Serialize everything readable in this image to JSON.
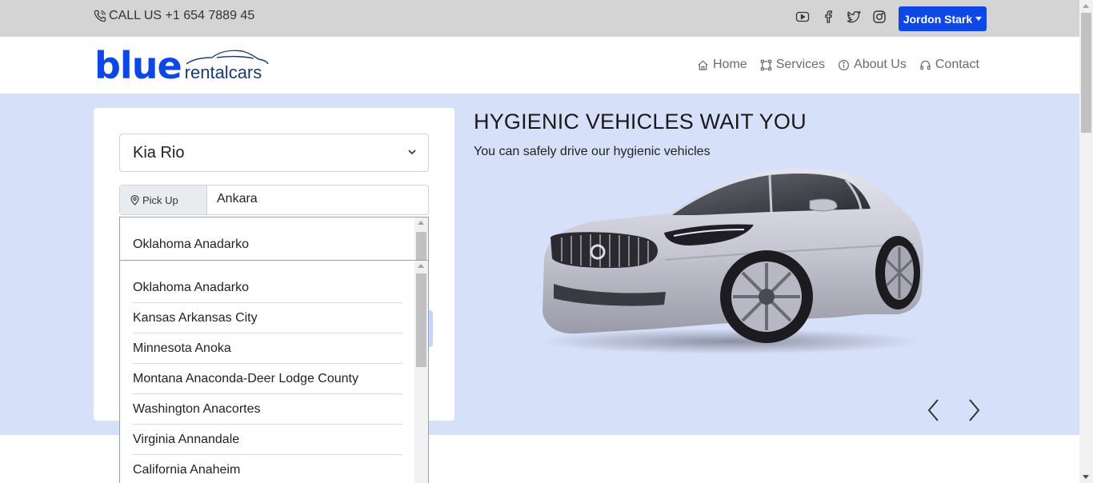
{
  "topbar": {
    "call_text": "CALL US +1 654 7889 45",
    "socials": [
      "youtube-icon",
      "facebook-icon",
      "twitter-icon",
      "instagram-icon"
    ],
    "user_name": "Jordon Stark",
    "bg_color": "#d4d4d4",
    "button_color": "#0d47e6"
  },
  "header": {
    "logo_main": "blue",
    "logo_sub": "rentalcars",
    "nav": [
      {
        "label": "Home",
        "icon": "home-icon"
      },
      {
        "label": "Services",
        "icon": "services-icon"
      },
      {
        "label": "About Us",
        "icon": "info-icon"
      },
      {
        "label": "Contact",
        "icon": "headset-icon"
      }
    ]
  },
  "hero": {
    "title": "HYGIENIC VEHICLES WAIT YOU",
    "subtitle": "You can safely drive our hygienic vehicles",
    "bg_color": "#d7e0f9"
  },
  "form": {
    "car_select": "Kia Rio",
    "pickup_label": "Pick Up",
    "pickup_value": "Ankara",
    "dropdown_selected": "Oklahoma Anadarko",
    "dropdown_options": [
      "Oklahoma Anadarko",
      "Kansas Arkansas City",
      "Minnesota Anoka",
      "Montana Anaconda-Deer Lodge County",
      "Washington Anacortes",
      "Virginia Annandale",
      "California Anaheim"
    ]
  }
}
